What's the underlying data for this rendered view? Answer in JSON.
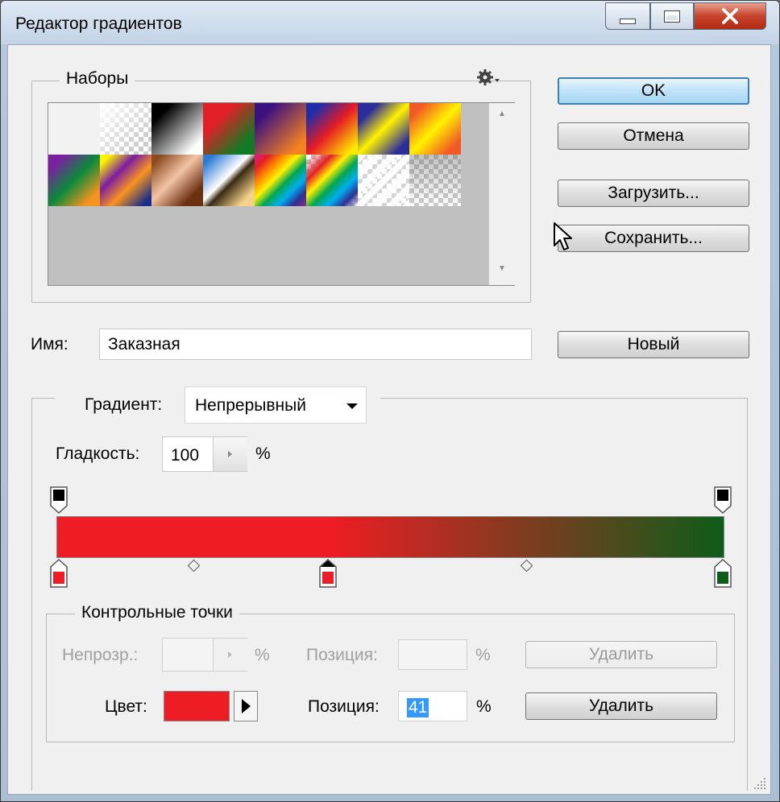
{
  "window": {
    "title": "Редактор градиентов",
    "minimize": "–",
    "maximize": "□",
    "close": "✕"
  },
  "presets": {
    "label": "Наборы",
    "menu_icon": "gear-icon",
    "scroll_up": "▲",
    "scroll_down": "▼"
  },
  "buttons": {
    "ok": "OK",
    "cancel": "Отмена",
    "load": "Загрузить...",
    "save": "Сохранить...",
    "new": "Новый"
  },
  "name": {
    "label": "Имя:",
    "value": "Заказная"
  },
  "gradient": {
    "type_label": "Градиент:",
    "type_value": "Непрерывный",
    "smoothness_label": "Гладкость:",
    "smoothness_value": "100",
    "smoothness_unit": "%",
    "colors": [
      "#ee1c24",
      "#ee1c24",
      "#0e5c1a"
    ],
    "color_stop_positions": [
      0,
      41,
      100
    ]
  },
  "stops": {
    "label": "Контрольные точки",
    "opacity_label": "Непрозр.:",
    "opacity_unit": "%",
    "opacity_position_label": "Позиция:",
    "opacity_position_unit": "%",
    "opacity_delete": "Удалить",
    "color_label": "Цвет:",
    "color_value": "#ee1c24",
    "color_position_label": "Позиция:",
    "color_position_value": "41",
    "color_position_unit": "%",
    "color_delete": "Удалить"
  }
}
